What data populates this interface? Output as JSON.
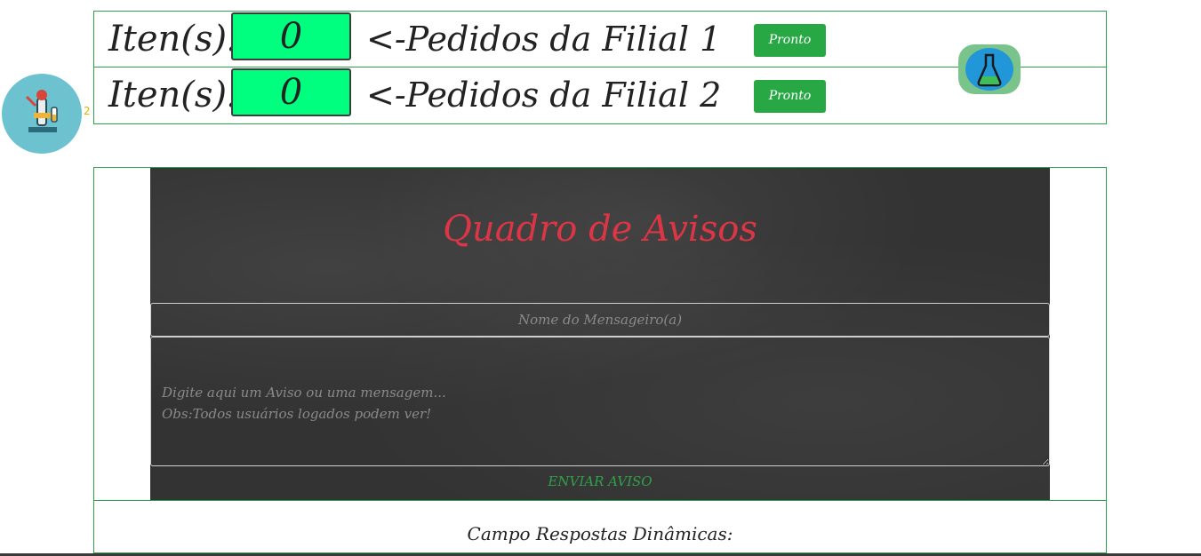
{
  "orders": {
    "rows": [
      {
        "label": "Iten(s):",
        "count": "0",
        "branch_text": "<-Pedidos da Filial 1",
        "ready_label": "Pronto"
      },
      {
        "label": "Iten(s):",
        "count": "0",
        "branch_text": "<-Pedidos da Filial 2",
        "ready_label": "Pronto"
      }
    ]
  },
  "floating": {
    "lab_icon": "microscope-lab-icon",
    "lab_badge": "2",
    "flask_icon": "flask-icon"
  },
  "board": {
    "title": "Quadro de Avisos",
    "name_placeholder": "Nome do Mensageiro(a)",
    "message_placeholder": "Digite aqui um Aviso ou uma mensagem...\nObs:Todos usuários logados podem ver!",
    "send_label": "ENVIAR AVISO"
  },
  "responses": {
    "title": "Campo Respostas Dinâmicas:"
  },
  "colors": {
    "accent_green": "#28a745",
    "count_green": "#00ff7f",
    "title_red": "#dc3545",
    "board_bg": "#333333"
  }
}
